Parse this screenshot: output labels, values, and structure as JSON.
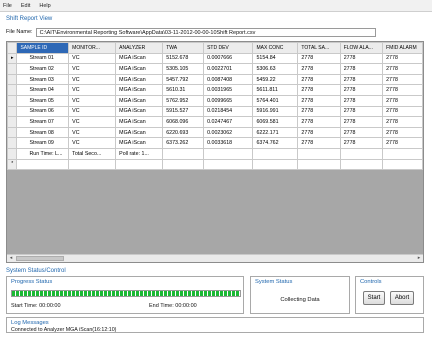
{
  "menu": [
    "File",
    "Edit",
    "Help"
  ],
  "view_title": "Shift Report View",
  "file": {
    "label": "File Name:",
    "path": "C:\\AIT\\Environmental Reporting Software\\AppData\\03-11-2012-00-00-10Shift Report.csv"
  },
  "grid": {
    "columns": [
      "SAMPLE ID",
      "MONITOR...",
      "ANALYZER",
      "TWA",
      "STD DEV",
      "MAX CONC",
      "TOTAL SA...",
      "FLOW ALA...",
      "FMID ALARM"
    ],
    "row_marker": "▸",
    "new_row_marker": "*",
    "rows": [
      [
        "Stream 01",
        "VC",
        "MGA iScan",
        "5152.678",
        "0.0007666",
        "5154.84",
        "2778",
        "2778",
        "2778"
      ],
      [
        "Stream 02",
        "VC",
        "MGA iScan",
        "5305.105",
        "0.0022701",
        "5306.63",
        "2778",
        "2778",
        "2778"
      ],
      [
        "Stream 03",
        "VC",
        "MGA iScan",
        "5457.792",
        "0.0087408",
        "5459.22",
        "2778",
        "2778",
        "2778"
      ],
      [
        "Stream 04",
        "VC",
        "MGA iScan",
        "5610.31",
        "0.0031965",
        "5611.811",
        "2778",
        "2778",
        "2778"
      ],
      [
        "Stream 05",
        "VC",
        "MGA iScan",
        "5762.952",
        "0.0099665",
        "5764.401",
        "2778",
        "2778",
        "2778"
      ],
      [
        "Stream 06",
        "VC",
        "MGA iScan",
        "5915.527",
        "0.0218454",
        "5916.991",
        "2778",
        "2778",
        "2778"
      ],
      [
        "Stream 07",
        "VC",
        "MGA iScan",
        "6068.096",
        "0.0247467",
        "6069.581",
        "2778",
        "2778",
        "2778"
      ],
      [
        "Stream 08",
        "VC",
        "MGA iScan",
        "6220.693",
        "0.0023062",
        "6222.171",
        "2778",
        "2778",
        "2778"
      ],
      [
        "Stream 09",
        "VC",
        "MGA iScan",
        "6373.262",
        "0.0033618",
        "6374.762",
        "2778",
        "2778",
        "2778"
      ],
      [
        "Run Time: L...",
        "Total Seco...",
        "Poll rate: 1...",
        "",
        "",
        "",
        "",
        "",
        ""
      ]
    ]
  },
  "system": {
    "title": "System Status/Control",
    "progress": {
      "title": "Progress Status",
      "value": 1.0,
      "start_time": "Start Time: 00:00:00",
      "end_time": "End Time: 00:00:00"
    },
    "status": {
      "title": "System Status",
      "text": "Collecting Data"
    },
    "controls": {
      "title": "Controls",
      "start": "Start",
      "abort": "Abort"
    },
    "log": {
      "title": "Log Messages",
      "text": "Connected to Analyzer MGA iScan(16:12:10)"
    }
  },
  "colors": {
    "accent": "#1f66ad",
    "selected_header": "#2e68b6",
    "progress": "#1bb934",
    "grid_background": "#a7a7a7"
  }
}
